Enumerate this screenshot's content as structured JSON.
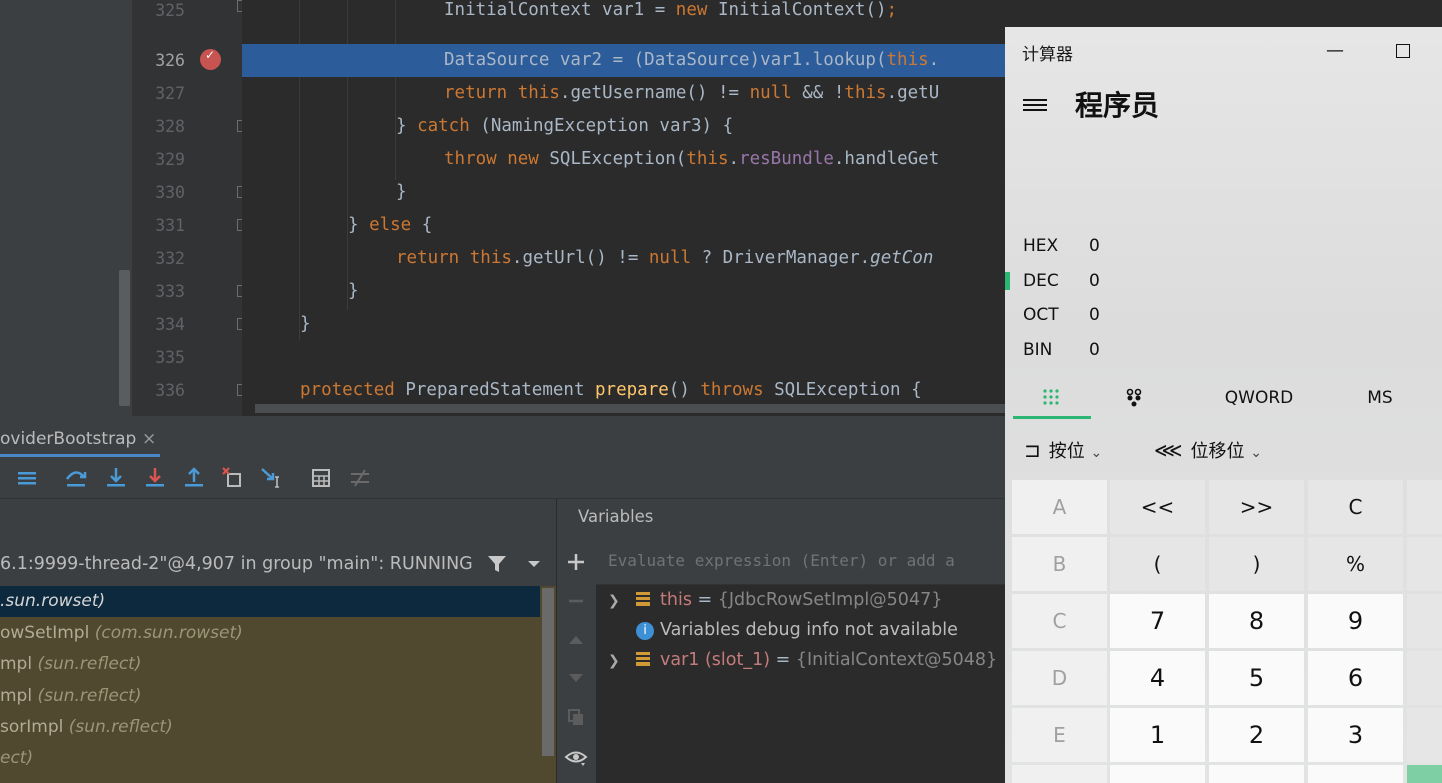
{
  "editor": {
    "line_numbers": [
      "325",
      "326",
      "327",
      "328",
      "329",
      "330",
      "331",
      "332",
      "333",
      "334",
      "335",
      "336"
    ],
    "current_line": "326",
    "code": {
      "l325": {
        "t1": "InitialContext var1 = ",
        "kw_new": "new",
        "t2": " InitialContext()",
        "semi": ";"
      },
      "l326": {
        "t1": "DataSource var2 = (DataSource)var1.lookup(",
        "kw_this": "this",
        "t2": "."
      },
      "l327": {
        "kw_return": "return",
        "kw_this1": "this",
        "t1": ".getUsername() != ",
        "kw_null": "null",
        "t2": " && !",
        "kw_this2": "this",
        "t3": ".getU"
      },
      "l328": {
        "t1": "} ",
        "kw_catch": "catch",
        "t2": " (NamingException var3) {"
      },
      "l329": {
        "kw_throw": "throw",
        "kw_new": "new",
        "t1": " SQLException(",
        "kw_this": "this",
        "t2": ".",
        "fld": "resBundle",
        "t3": ".handleGet"
      },
      "l330": {
        "t1": "}"
      },
      "l331": {
        "t1": "} ",
        "kw_else": "else",
        "t2": " {"
      },
      "l332": {
        "kw_return": "return",
        "kw_this": "this",
        "t1": ".getUrl() != ",
        "kw_null": "null",
        "t2": " ? DriverManager.",
        "it": "getCon"
      },
      "l333": {
        "t1": "}"
      },
      "l334": {
        "t1": "}"
      },
      "l336": {
        "kw_protected": "protected",
        "t1": " PreparedStatement ",
        "fn": "prepare",
        "t2": "() ",
        "kw_throws": "throws",
        "t3": " SQLException {"
      }
    }
  },
  "debug": {
    "tab_label": "oviderBootstrap",
    "tab_close": "×",
    "thread_text": "6.1:9999-thread-2\"@4,907 in group \"main\": RUNNING",
    "frames": [
      {
        "name": "",
        "pkg": ".sun.rowset)"
      },
      {
        "name": "owSetImpl ",
        "pkg": "(com.sun.rowset)"
      },
      {
        "name": "mpl ",
        "pkg": "(sun.reflect)"
      },
      {
        "name": "mpl ",
        "pkg": "(sun.reflect)"
      },
      {
        "name": "sorImpl ",
        "pkg": "(sun.reflect)"
      },
      {
        "name": "",
        "pkg": "ect)"
      }
    ],
    "variables_title": "Variables",
    "eval_placeholder": "Evaluate expression (Enter) or add a",
    "vars": [
      {
        "name": "this",
        "eq": " = ",
        "value": "{JdbcRowSetImpl@5047}"
      },
      {
        "info": "Variables debug info not available"
      },
      {
        "name": "var1 (slot_1)",
        "eq": " = ",
        "value": "{InitialContext@5048}"
      }
    ]
  },
  "calculator": {
    "title": "计算器",
    "mode": "程序员",
    "bases": [
      {
        "label": "HEX",
        "value": "0"
      },
      {
        "label": "DEC",
        "value": "0"
      },
      {
        "label": "OCT",
        "value": "0"
      },
      {
        "label": "BIN",
        "value": "0"
      }
    ],
    "word_size": "QWORD",
    "memory": "MS",
    "bitwise_label": "按位",
    "bitshift_label": "位移位",
    "keys": [
      [
        "A",
        "<<",
        ">>",
        "C"
      ],
      [
        "B",
        "(",
        ")",
        "%"
      ],
      [
        "C",
        "7",
        "8",
        "9"
      ],
      [
        "D",
        "4",
        "5",
        "6"
      ],
      [
        "E",
        "1",
        "2",
        "3"
      ]
    ],
    "accent": "#2bb673"
  }
}
